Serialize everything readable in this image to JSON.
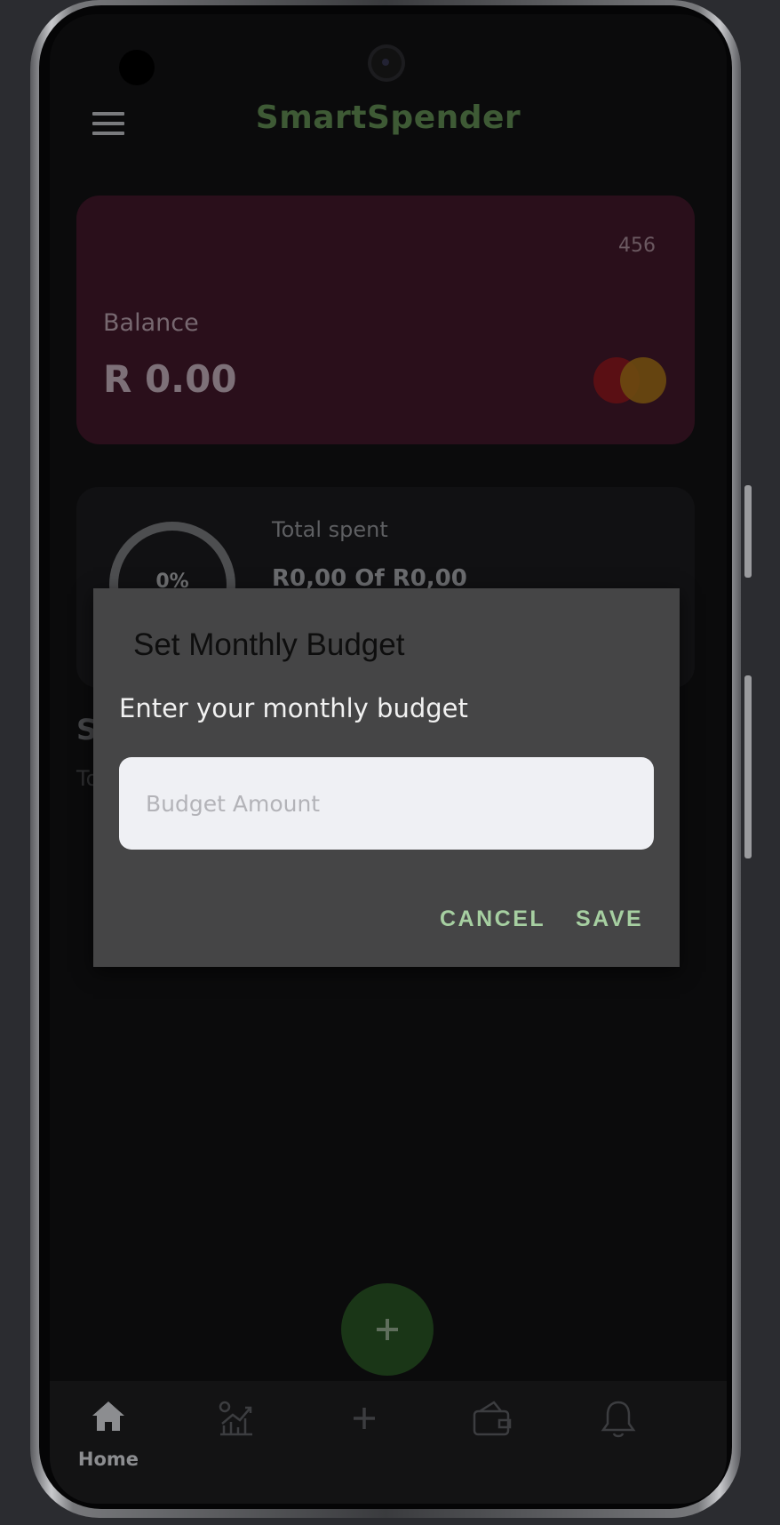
{
  "app": {
    "title": "SmartSpender"
  },
  "balance_card": {
    "card_number": "456",
    "label": "Balance",
    "value": "R 0.00",
    "brand_icon": "mastercard-logo"
  },
  "spent_card": {
    "percent": "0%",
    "progress_fraction": 0,
    "label": "Total spent",
    "value": "R0,00 Of R0,00"
  },
  "background_section": {
    "heading_partial": "S",
    "sub_partial": "To"
  },
  "dialog": {
    "title": "Set Monthly Budget",
    "message": "Enter your monthly budget",
    "input": {
      "placeholder": "Budget Amount",
      "value": ""
    },
    "cancel_label": "CANCEL",
    "save_label": "SAVE"
  },
  "fab": {
    "icon": "plus-icon"
  },
  "bottom_nav": {
    "items": [
      {
        "label": "Home",
        "icon": "home-icon",
        "active": true
      },
      {
        "label": "",
        "icon": "reports-icon"
      },
      {
        "label": "",
        "icon": "plus-icon"
      },
      {
        "label": "",
        "icon": "wallet-icon"
      },
      {
        "label": "",
        "icon": "bell-icon"
      }
    ]
  },
  "colors": {
    "accent": "#a6cfa1",
    "card": "#2a0f1b",
    "dialog": "#454546",
    "fab": "#1a3617"
  }
}
